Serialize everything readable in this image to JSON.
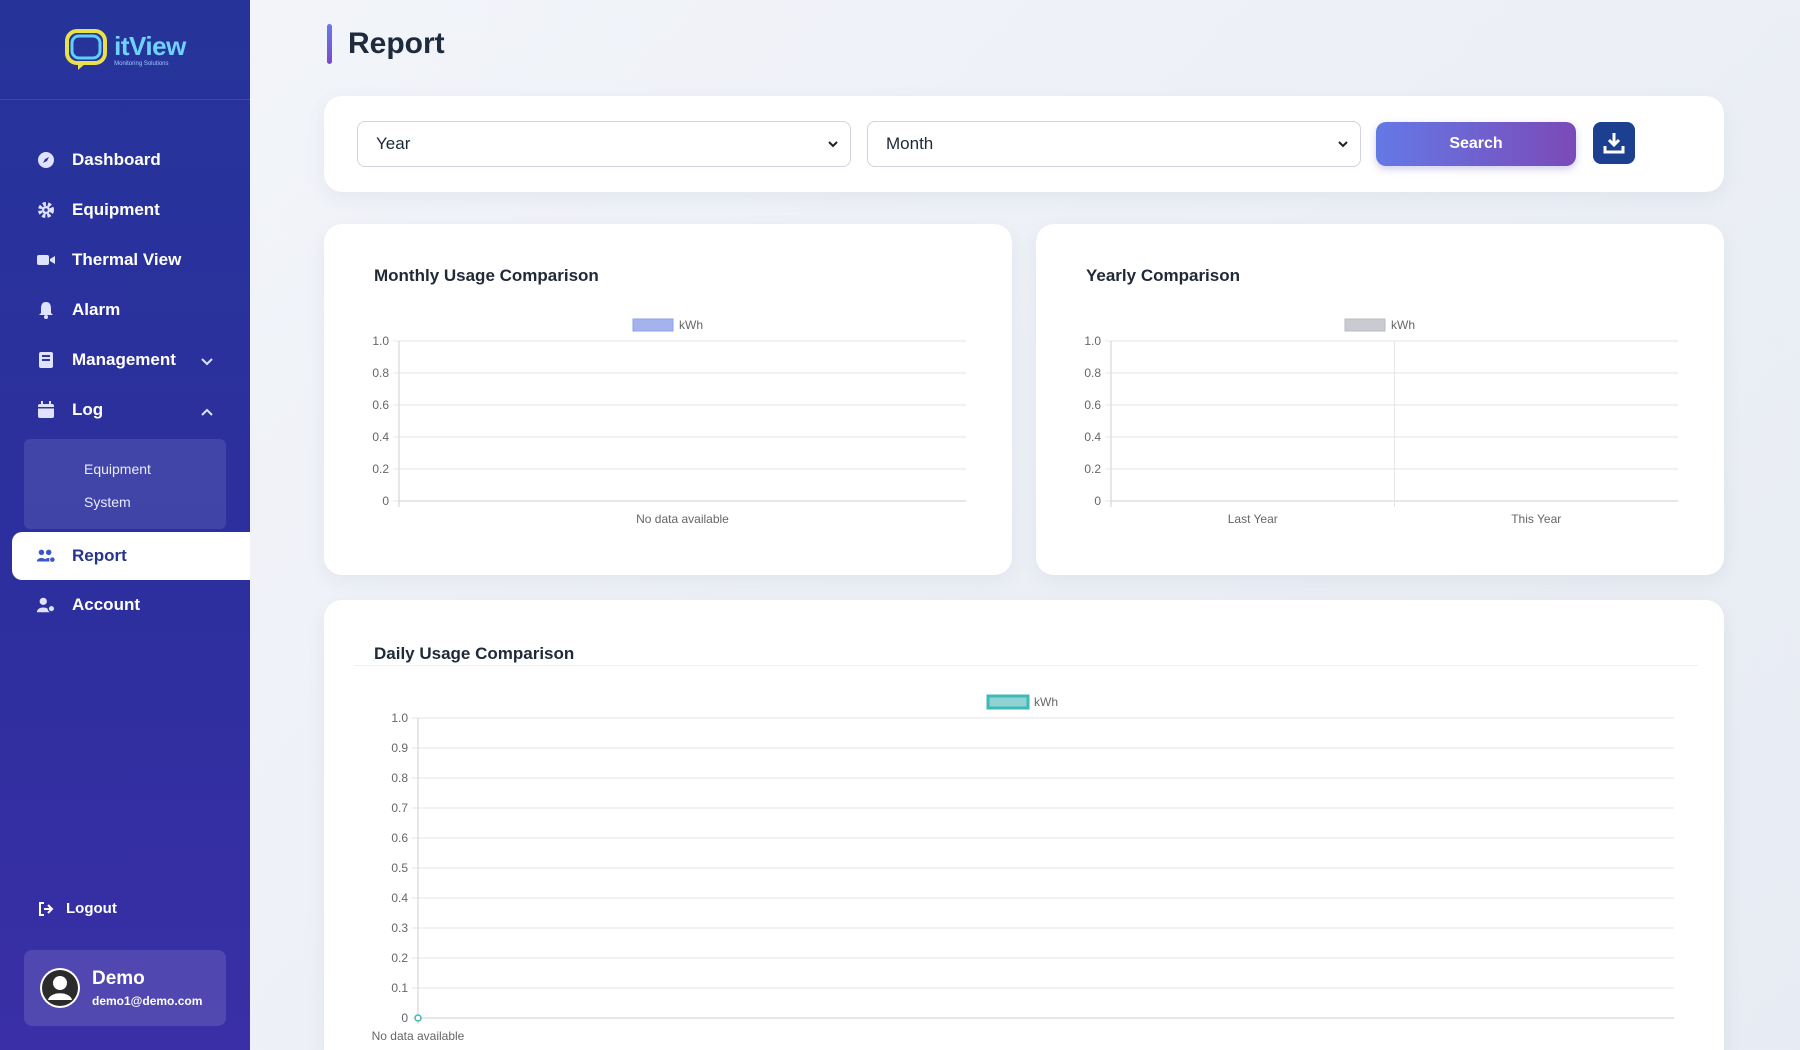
{
  "app": {
    "logo_name": "itView",
    "logo_sub": "Monitoring Solutions"
  },
  "sidebar": {
    "items": [
      {
        "label": "Dashboard",
        "icon": "compass-icon"
      },
      {
        "label": "Equipment",
        "icon": "gear-icon"
      },
      {
        "label": "Thermal View",
        "icon": "video-camera-icon"
      },
      {
        "label": "Alarm",
        "icon": "bell-icon"
      },
      {
        "label": "Management",
        "icon": "book-icon"
      },
      {
        "label": "Log",
        "icon": "calendar-icon"
      }
    ],
    "log_sub": [
      "Equipment",
      "System"
    ],
    "report": "Report",
    "account": "Account",
    "logout": "Logout"
  },
  "user": {
    "name": "Demo",
    "email": "demo1@demo.com"
  },
  "page": {
    "title": "Report"
  },
  "filters": {
    "year": "Year",
    "month": "Month",
    "search_label": "Search"
  },
  "colors": {
    "monthly_series": "#a4b3ee",
    "yearly_series": "#c9cbd1",
    "daily_series": "#8fd3d3",
    "accent": "#6479e6",
    "sidebar": "#2a329e"
  },
  "chart_data": [
    {
      "type": "bar",
      "title": "Monthly Usage Comparison",
      "categories": [
        "No data available"
      ],
      "series": [
        {
          "name": "kWh",
          "values": []
        }
      ],
      "ylim": [
        0,
        1.0
      ],
      "yticks": [
        "1.0",
        "0.8",
        "0.6",
        "0.4",
        "0.2",
        "0"
      ],
      "grid": true,
      "legend": "top-center"
    },
    {
      "type": "bar",
      "title": "Yearly Comparison",
      "categories": [
        "Last Year",
        "This Year"
      ],
      "series": [
        {
          "name": "kWh",
          "values": []
        }
      ],
      "ylim": [
        0,
        1.0
      ],
      "yticks": [
        "1.0",
        "0.8",
        "0.6",
        "0.4",
        "0.2",
        "0"
      ],
      "grid": true,
      "legend": "top-center"
    },
    {
      "type": "line",
      "title": "Daily Usage Comparison",
      "categories": [
        "No data available"
      ],
      "series": [
        {
          "name": "kWh",
          "values": [
            0
          ]
        }
      ],
      "ylim": [
        0,
        1.0
      ],
      "yticks": [
        "1.0",
        "0.9",
        "0.8",
        "0.7",
        "0.6",
        "0.5",
        "0.4",
        "0.3",
        "0.2",
        "0.1",
        "0"
      ],
      "grid": true,
      "legend": "top-center"
    }
  ]
}
